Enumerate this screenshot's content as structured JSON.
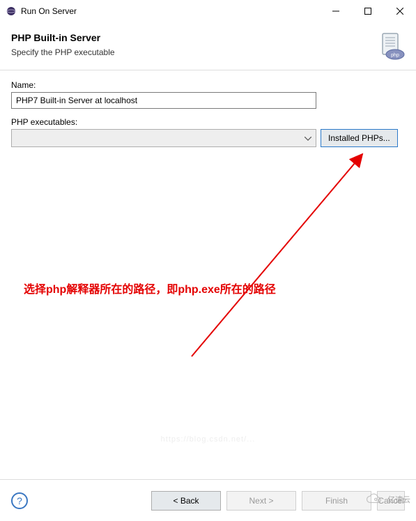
{
  "window": {
    "title": "Run On Server"
  },
  "header": {
    "title": "PHP Built-in Server",
    "subtitle": "Specify the PHP executable",
    "icon_label": "php"
  },
  "form": {
    "name_label": "Name:",
    "name_value": "PHP7 Built-in Server at localhost",
    "exec_label": "PHP executables:",
    "exec_value": "",
    "installed_button": "Installed PHPs..."
  },
  "annotation": {
    "text": "选择php解释器所在的路径，即php.exe所在的路径"
  },
  "footer": {
    "back": "< Back",
    "next": "Next >",
    "finish": "Finish",
    "cancel": "Cancel"
  },
  "watermark": {
    "brand": "亿速云",
    "bg": "https://blog.csdn.net/..."
  }
}
